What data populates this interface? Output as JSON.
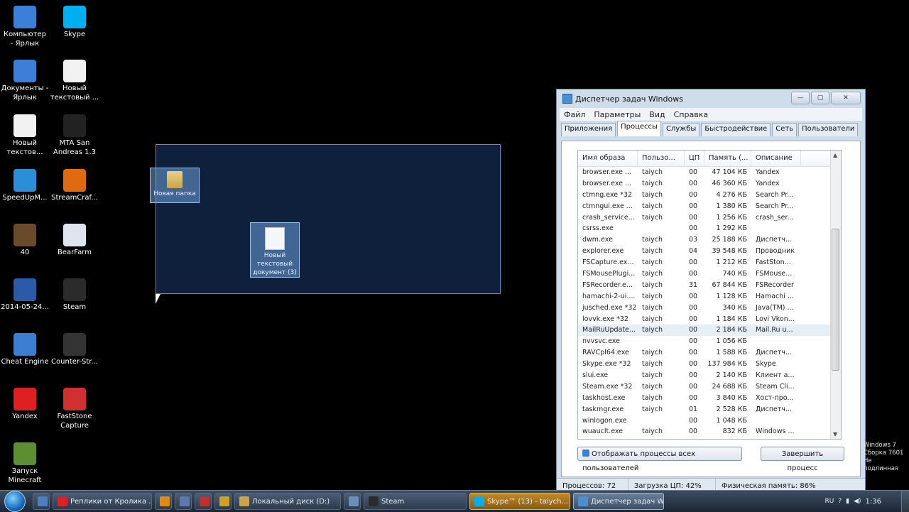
{
  "desktop": {
    "icons": [
      {
        "label": "Компьютер\n- Ярлык",
        "icon": "computer-icon",
        "color": "#3b7fd8"
      },
      {
        "label": "Skype",
        "icon": "skype-icon",
        "color": "#00aff0"
      },
      {
        "label": "Документы -\nЯрлык",
        "icon": "documents-icon",
        "color": "#3b7fd8"
      },
      {
        "label": "Новый\nтекстовый ...",
        "icon": "text-file-icon",
        "color": "#f2f2f2"
      },
      {
        "label": "Новый\nтекстов...",
        "icon": "text-file-icon",
        "color": "#f2f2f2"
      },
      {
        "label": "MTA San\nAndreas 1.3",
        "icon": "mta-icon",
        "color": "#222222"
      },
      {
        "label": "SpeedUpM...",
        "icon": "speedup-icon",
        "color": "#2a8fd8"
      },
      {
        "label": "StreamCraf...",
        "icon": "streamcraft-icon",
        "color": "#e06a10"
      },
      {
        "label": "40",
        "icon": "archive-icon",
        "color": "#6b4a2a"
      },
      {
        "label": "BearFarm",
        "icon": "document-icon",
        "color": "#dde6ee"
      },
      {
        "label": "2014-05-24...",
        "icon": "video-icon",
        "color": "#2a5aa8"
      },
      {
        "label": "Steam",
        "icon": "steam-icon",
        "color": "#2b2b2b"
      },
      {
        "label": "Cheat Engine",
        "icon": "cheat-engine-icon",
        "color": "#3a7fd0"
      },
      {
        "label": "Counter-Str...",
        "icon": "counter-strike-icon",
        "color": "#333333"
      },
      {
        "label": "Yandex",
        "icon": "yandex-icon",
        "color": "#e02020"
      },
      {
        "label": "FastStone\nCapture",
        "icon": "faststone-icon",
        "color": "#d03030"
      },
      {
        "label": "Запуск\nMinecraft",
        "icon": "minecraft-icon",
        "color": "#5b8f32"
      }
    ],
    "selected_icons": [
      {
        "label": "Новая папка",
        "icon": "folder-icon"
      },
      {
        "label": "Новый\nтекстовый\nдокумент (3)",
        "icon": "text-file-icon"
      }
    ]
  },
  "task_manager": {
    "title": "Диспетчер задач Windows",
    "controls": {
      "minimize": "—",
      "maximize": "▢",
      "close": "✕"
    },
    "menu": [
      "Файл",
      "Параметры",
      "Вид",
      "Справка"
    ],
    "tabs": [
      "Приложения",
      "Процессы",
      "Службы",
      "Быстродействие",
      "Сеть",
      "Пользователи"
    ],
    "active_tab": "Процессы",
    "columns": [
      "Имя образа",
      "Пользо...",
      "ЦП",
      "Память (...",
      "Описание"
    ],
    "rows": [
      [
        "browser.exe ...",
        "taiych",
        "00",
        "47 104 КБ",
        "Yandex"
      ],
      [
        "browser.exe ...",
        "taiych",
        "00",
        "46 360 КБ",
        "Yandex"
      ],
      [
        "ctmng.exe *32",
        "taiych",
        "00",
        "4 276 КБ",
        "Search Pr..."
      ],
      [
        "ctmngui.exe ...",
        "taiych",
        "00",
        "1 380 КБ",
        "Search Pr..."
      ],
      [
        "crash_service...",
        "taiych",
        "00",
        "1 256 КБ",
        "crash_ser..."
      ],
      [
        "csrss.exe",
        "",
        "00",
        "1 292 КБ",
        ""
      ],
      [
        "dwm.exe",
        "taiych",
        "03",
        "25 188 КБ",
        "Диспетч..."
      ],
      [
        "explorer.exe",
        "taiych",
        "04",
        "39 548 КБ",
        "Проводник"
      ],
      [
        "FSCapture.ex...",
        "taiych",
        "00",
        "1 212 КБ",
        "FastSton..."
      ],
      [
        "FSMousePlugi...",
        "taiych",
        "00",
        "740 КБ",
        "FSMouse..."
      ],
      [
        "FSRecorder.e...",
        "taiych",
        "31",
        "67 844 КБ",
        "FSRecorder"
      ],
      [
        "hamachi-2-ui....",
        "taiych",
        "00",
        "1 128 КБ",
        "Hamachi ..."
      ],
      [
        "jusched.exe *32",
        "taiych",
        "00",
        "340 КБ",
        "Java(TM) ..."
      ],
      [
        "lovvk.exe *32",
        "taiych",
        "00",
        "1 184 КБ",
        "Lovi Vkon..."
      ],
      [
        "MailRuUpdate...",
        "taiych",
        "00",
        "2 184 КБ",
        "Mail.Ru u..."
      ],
      [
        "nvvsvc.exe",
        "",
        "00",
        "1 056 КБ",
        ""
      ],
      [
        "RAVCpl64.exe",
        "taiych",
        "00",
        "1 588 КБ",
        "Диспетч..."
      ],
      [
        "Skype.exe *32",
        "taiych",
        "00",
        "137 984 КБ",
        "Skype"
      ],
      [
        "slui.exe",
        "taiych",
        "00",
        "2 140 КБ",
        "Клиент а..."
      ],
      [
        "Steam.exe *32",
        "taiych",
        "00",
        "24 688 КБ",
        "Steam Cli..."
      ],
      [
        "taskhost.exe",
        "taiych",
        "00",
        "3 840 КБ",
        "Хост-про..."
      ],
      [
        "taskmgr.exe",
        "taiych",
        "01",
        "2 528 КБ",
        "Диспетч..."
      ],
      [
        "winlogon.exe",
        "",
        "00",
        "1 048 КБ",
        ""
      ],
      [
        "wuauclt.exe",
        "taiych",
        "00",
        "832 КБ",
        "Windows ..."
      ]
    ],
    "selected_row": 14,
    "show_all_button": "Отображать процессы всех пользователей",
    "end_process_button": "Завершить процесс",
    "status": {
      "processes": "Процессов: 72",
      "cpu": "Загрузка ЦП: 42%",
      "memory": "Физическая память: 86%"
    }
  },
  "taskbar": {
    "buttons": [
      {
        "label": "",
        "icon": "explorer-icon",
        "state": "normal"
      },
      {
        "label": "Реплики от Кролика ...",
        "icon": "yandex-browser-icon",
        "state": "normal"
      },
      {
        "label": "",
        "icon": "media-player-icon",
        "state": "normal"
      },
      {
        "label": "",
        "icon": "mail-icon",
        "state": "normal"
      },
      {
        "label": "",
        "icon": "record-icon",
        "state": "normal"
      },
      {
        "label": "",
        "icon": "pencil-icon",
        "state": "normal"
      },
      {
        "label": "Локальный диск (D:)",
        "icon": "folder-icon",
        "state": "normal"
      },
      {
        "label": "",
        "icon": "monitor-icon",
        "state": "normal"
      },
      {
        "label": "Steam",
        "icon": "steam-icon",
        "state": "normal"
      },
      {
        "label": "Skype™ (13) - taiych...",
        "icon": "skype-icon",
        "state": "active"
      },
      {
        "label": "Диспетчер задач W...",
        "icon": "task-manager-icon",
        "state": "current"
      }
    ],
    "tray": {
      "language": "RU",
      "time": "1:36"
    }
  },
  "watermark": "Windows 7\nСборка 7601\nНе подлинная"
}
